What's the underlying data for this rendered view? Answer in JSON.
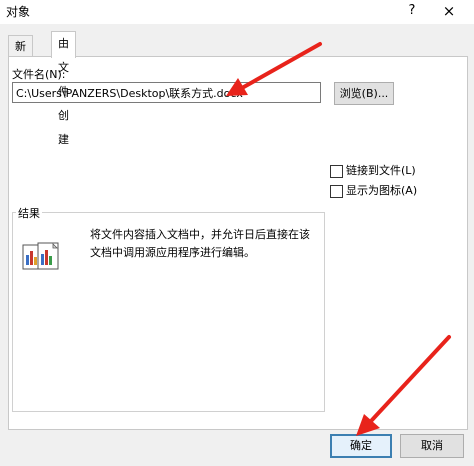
{
  "window": {
    "title": "对象",
    "help_label": "?",
    "close_label": "×"
  },
  "tabs": [
    {
      "label": "新建"
    },
    {
      "label": "由文件创建",
      "active": true
    }
  ],
  "file": {
    "label": "文件名(N):",
    "value": "C:\\Users\\PANZERS\\Desktop\\联系方式.docx",
    "browse_label": "浏览(B)..."
  },
  "options": {
    "link_label": "链接到文件(L)",
    "link_checked": false,
    "icon_label": "显示为图标(A)",
    "icon_checked": false
  },
  "result": {
    "title": "结果",
    "description": "将文件内容插入文档中，并允许日后直接在该文档中调用源应用程序进行编辑。",
    "icon": "embedded-document-icon"
  },
  "footer": {
    "ok_label": "确定",
    "cancel_label": "取消"
  },
  "annotation": {
    "arrow_color": "#e8231b"
  }
}
